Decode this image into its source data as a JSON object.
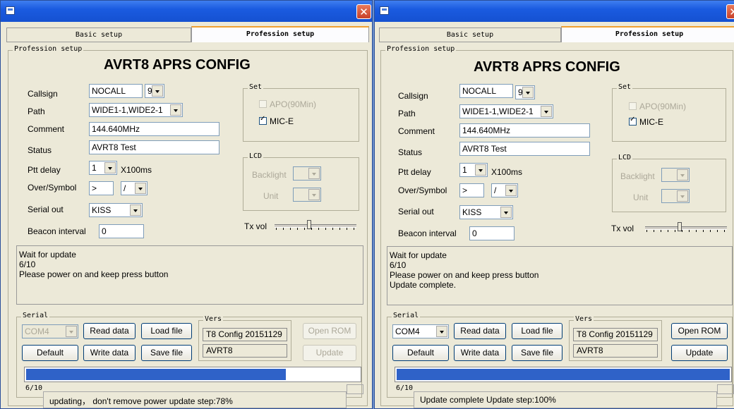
{
  "windows": [
    {
      "tabs": {
        "basic": "Basic setup",
        "profession": "Profession setup"
      },
      "group_title": "Profession setup",
      "title": "AVRT8 APRS CONFIG",
      "fields": {
        "callsign_label": "Callsign",
        "callsign": "NOCALL",
        "ssid": "9",
        "path_label": "Path",
        "path": "WIDE1-1,WIDE2-1",
        "comment_label": "Comment",
        "comment": "144.640MHz",
        "status_label": "Status",
        "status": "AVRT8 Test",
        "ptt_label": "Ptt delay",
        "ptt": "1",
        "ptt_unit": "X100ms",
        "over_label": "Over/Symbol",
        "over": ">",
        "symbol": "/",
        "serial_out_label": "Serial out",
        "serial_out": "KISS",
        "beacon_label": "Beacon interval",
        "beacon": "0"
      },
      "set": {
        "title": "Set",
        "apo": "APO(90Min)",
        "apo_checked": false,
        "mice": "MIC-E",
        "mice_checked": true
      },
      "lcd": {
        "title": "LCD",
        "backlight": "Backlight",
        "unit": "Unit"
      },
      "txvol": {
        "label": "Tx vol",
        "level": 0.42
      },
      "log": [
        "Wait for update",
        " 6/10",
        "Please power on and keep press button"
      ],
      "serial": {
        "title": "Serial",
        "port": "COM4",
        "port_enabled": false,
        "read": "Read data",
        "load": "Load file",
        "default": "Default",
        "write": "Write data",
        "save": "Save file",
        "vers_title": "Vers",
        "vers1": "T8 Config 20151129",
        "vers2": "AVRT8",
        "open_rom": "Open ROM",
        "update": "Update",
        "rom_enabled": false
      },
      "progress": 0.78,
      "step": "6/10",
      "status_message": "updating， don't remove power update step:78%"
    },
    {
      "tabs": {
        "basic": "Basic setup",
        "profession": "Profession setup"
      },
      "group_title": "Profession setup",
      "title": "AVRT8 APRS CONFIG",
      "fields": {
        "callsign_label": "Callsign",
        "callsign": "NOCALL",
        "ssid": "9",
        "path_label": "Path",
        "path": "WIDE1-1,WIDE2-1",
        "comment_label": "Comment",
        "comment": "144.640MHz",
        "status_label": "Status",
        "status": "AVRT8 Test",
        "ptt_label": "Ptt delay",
        "ptt": "1",
        "ptt_unit": "X100ms",
        "over_label": "Over/Symbol",
        "over": ">",
        "symbol": "/",
        "serial_out_label": "Serial out",
        "serial_out": "KISS",
        "beacon_label": "Beacon interval",
        "beacon": "0"
      },
      "set": {
        "title": "Set",
        "apo": "APO(90Min)",
        "apo_checked": false,
        "mice": "MIC-E",
        "mice_checked": true
      },
      "lcd": {
        "title": "LCD",
        "backlight": "Backlight",
        "unit": "Unit"
      },
      "txvol": {
        "label": "Tx vol",
        "level": 0.42
      },
      "log": [
        "Wait for update",
        " 6/10",
        "Please power on and keep press button",
        "Update complete."
      ],
      "serial": {
        "title": "Serial",
        "port": "COM4",
        "port_enabled": true,
        "read": "Read data",
        "load": "Load file",
        "default": "Default",
        "write": "Write data",
        "save": "Save file",
        "vers_title": "Vers",
        "vers1": "T8 Config 20151129",
        "vers2": "AVRT8",
        "open_rom": "Open ROM",
        "update": "Update",
        "rom_enabled": true
      },
      "progress": 1.0,
      "step": "6/10",
      "status_message": "Update complete Update step:100%"
    }
  ]
}
